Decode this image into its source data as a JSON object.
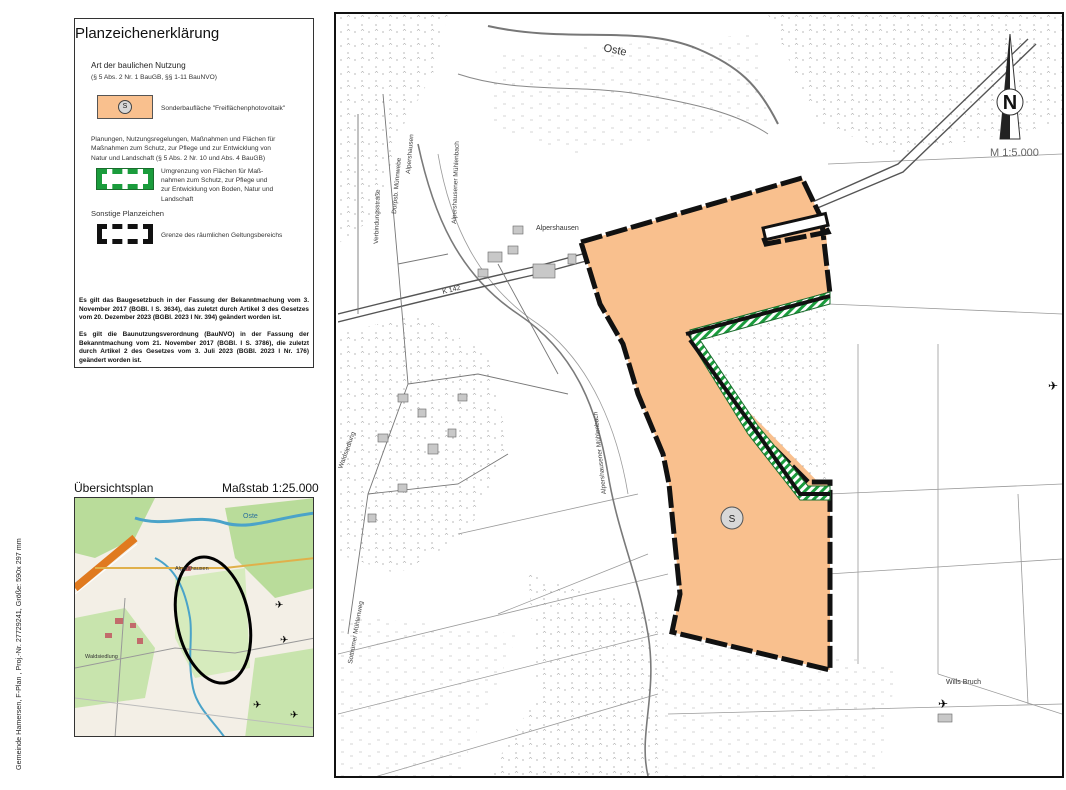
{
  "legend": {
    "title": "Planzeichenerklärung",
    "section1_heading": "Art der baulichen Nutzung",
    "section1_ref": "(§ 5 Abs. 2 Nr. 1 BauGB, §§ 1-11 BauNVO)",
    "item_sonder_label": "Sonderbaufläche \"Freiflächenphotovoltaik\"",
    "item_sonder_symbol": "S",
    "section2_heading_lines": [
      "Planungen, Nutzungsregelungen, Maßnahmen und Flächen für",
      "Maßnahmen zum Schutz, zur Pflege und zur Entwicklung von",
      "Natur und Landschaft (§ 5 Abs. 2 Nr. 10 und Abs. 4 BauGB)"
    ],
    "item_green_lines": [
      "Umgrenzung von Flächen für Maß-",
      "nahmen zum Schutz, zur Pflege und",
      "zur Entwicklung von Boden, Natur und",
      "Landschaft"
    ],
    "section3_heading": "Sonstige Planzeichen",
    "item_boundary_label": "Grenze des räumlichen Geltungsbereichs",
    "legal_baugb": "Es gilt das Baugesetzbuch in der Fassung der Bekanntmachung vom 3. November 2017 (BGBl. I S. 3634), das zuletzt durch Artikel 3 des Gesetzes vom 20. Dezember 2023 (BGBl. 2023 I Nr. 394) geändert worden ist.",
    "legal_baunvo": "Es gilt die Baunutzungsverordnung (BauNVO) in der Fassung der Bekanntmachung vom 21. November 2017 (BGBl. I S. 3786), die zuletzt durch Artikel 2 des Gesetzes vom 3. Juli 2023 (BGBl. 2023 I Nr. 176) geändert worden ist."
  },
  "overview": {
    "title": "Übersichtsplan",
    "scale": "Maßstab 1:25.000",
    "labels": {
      "oste": "Oste",
      "alpershausen": "Alpershausen",
      "waldsiedlung": "Waldsiedlung"
    }
  },
  "side_label": "Gemeinde Hamersen, F-Plan , Proj.-Nr. 27729241, Größe: 590x 297 mm",
  "map": {
    "scale": "M 1:5.000",
    "north": "N",
    "plan_symbol": "S",
    "labels": {
      "oste": "Oste",
      "alpershausen": "Alpershausen",
      "road_k142": "K 142",
      "wills_bruch": "Wills Bruch",
      "alpershausener_muehlenbach_1": "Alpershausener Mühlenbach",
      "alpershausener_muehlenbach_2": "Alpershausener Mühlenbach",
      "alpershausen_vertical": "Alpershausen",
      "doerpstrasse": "Dorpsb. Münnwebe",
      "verbindungsstrasse": "Verbindungsstraße",
      "waldsiedlung": "Waldsiedlung",
      "sottrumer_muehlenweg": "Sottrumer Mühlenweg"
    }
  },
  "colors": {
    "sonder_fill": "#f9c08e",
    "green_hatch": "#1a9c3c",
    "boundary": "#111111",
    "overview_forest": "#b9dc9a",
    "overview_water": "#4aa3c9"
  }
}
